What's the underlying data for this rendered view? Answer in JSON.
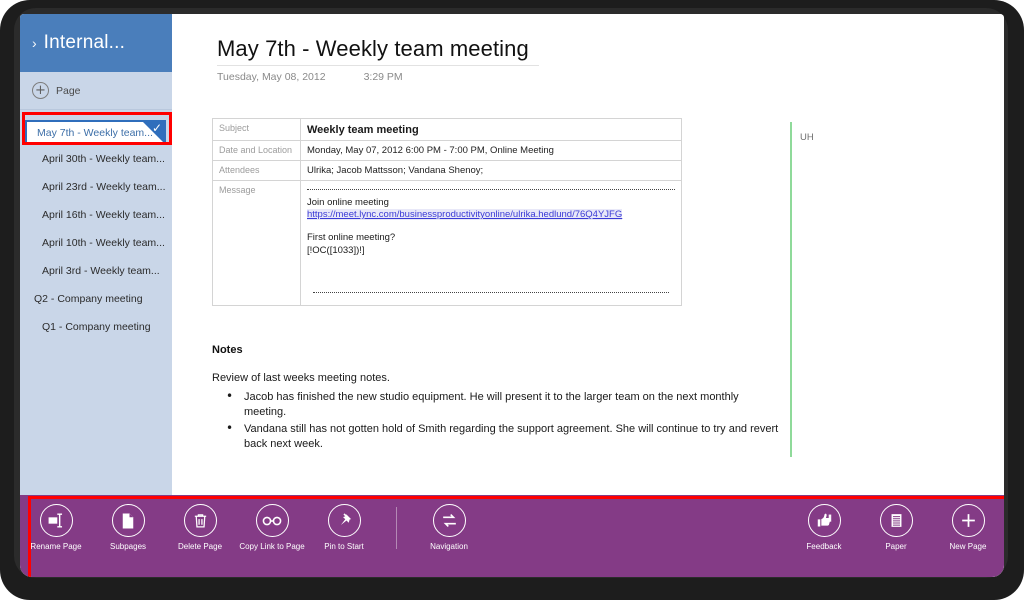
{
  "notebook": {
    "chevron": "›",
    "title": "Internal...",
    "add_page_label": "Page",
    "add_page_icon": "plus-icon"
  },
  "sidebar": {
    "pages": [
      {
        "label": "May 7th - Weekly team...",
        "selected": true,
        "indent": 1
      },
      {
        "label": "April 30th - Weekly team...",
        "selected": false,
        "indent": 1
      },
      {
        "label": "April 23rd - Weekly team...",
        "selected": false,
        "indent": 1
      },
      {
        "label": "April 16th - Weekly team...",
        "selected": false,
        "indent": 1
      },
      {
        "label": "April 10th - Weekly team...",
        "selected": false,
        "indent": 1
      },
      {
        "label": "April 3rd - Weekly team...",
        "selected": false,
        "indent": 1
      },
      {
        "label": "Q2 - Company meeting",
        "selected": false,
        "indent": 0
      },
      {
        "label": "Q1 - Company meeting",
        "selected": false,
        "indent": 1
      }
    ],
    "selected_check": "✓"
  },
  "page": {
    "title": "May 7th - Weekly team meeting",
    "date": "Tuesday, May 08, 2012",
    "time": "3:29 PM"
  },
  "meeting_table": {
    "rows": [
      {
        "label": "Subject",
        "value": "Weekly team meeting"
      },
      {
        "label": "Date and Location",
        "value": "Monday, May 07, 2012 6:00 PM - 7:00 PM, Online Meeting"
      },
      {
        "label": "Attendees",
        "value": "Ulrika; Jacob Mattsson; Vandana Shenoy;"
      },
      {
        "label": "Message",
        "value": ""
      }
    ],
    "message": {
      "join_text": "Join online meeting",
      "join_link": "https://meet.lync.com/businessproductivityonline/ulrika.hedlund/76Q4YJFG",
      "first_question": "First online meeting?",
      "oc_token": "[!OC([1033])!]"
    }
  },
  "notes": {
    "heading": "Notes",
    "intro": "Review of last weeks meeting notes.",
    "bullets": [
      "Jacob has finished the new studio equipment.  He will present it to the larger team on the next monthly meeting.",
      "Vandana still has not gotten hold of Smith regarding the support agreement. She will continue to try and revert back next week."
    ]
  },
  "author_mark": {
    "initials": "UH",
    "color": "#8fda9a"
  },
  "appbar": {
    "background": "#843b86",
    "left_commands": [
      {
        "label": "Rename Page",
        "icon": "rename-page-icon"
      },
      {
        "label": "Subpages",
        "icon": "subpages-icon"
      },
      {
        "label": "Delete Page",
        "icon": "trash-icon"
      },
      {
        "label": "Copy Link to Page",
        "icon": "link-icon"
      },
      {
        "label": "Pin to Start",
        "icon": "pin-icon"
      }
    ],
    "mid_commands": [
      {
        "label": "Navigation",
        "icon": "navigation-icon"
      }
    ],
    "right_commands": [
      {
        "label": "Feedback",
        "icon": "feedback-icon"
      },
      {
        "label": "Paper",
        "icon": "paper-icon"
      },
      {
        "label": "New Page",
        "icon": "plus-icon"
      }
    ]
  },
  "annotations": {
    "highlight_color": "#ff0000",
    "selected_page_box": "highlight-selected-page",
    "appbar_box": "highlight-appbar"
  }
}
